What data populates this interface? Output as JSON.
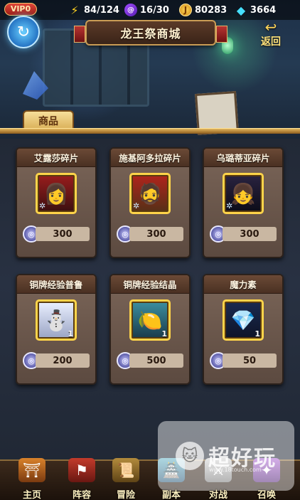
{
  "topbar": {
    "vip_label": "VIP0",
    "energy": "84/124",
    "spiral": "16/30",
    "coins": "80283",
    "gems": "3664"
  },
  "icons": {
    "energy": "lightning-icon",
    "spiral": "spiral-token-icon",
    "coin": "gold-coin-icon",
    "gem": "diamond-icon",
    "currency": "shop-token-icon"
  },
  "header": {
    "title": "龙王祭商城",
    "back_label": "返回"
  },
  "tabs": [
    {
      "label": "商品",
      "active": true
    }
  ],
  "items": [
    {
      "name": "艾露莎碎片",
      "price": "300",
      "fragment": true,
      "count": ""
    },
    {
      "name": "施基阿多拉碎片",
      "price": "300",
      "fragment": true,
      "count": ""
    },
    {
      "name": "乌璐蒂亚碎片",
      "price": "300",
      "fragment": true,
      "count": ""
    },
    {
      "name": "铜牌经验普鲁",
      "price": "200",
      "fragment": false,
      "count": "1"
    },
    {
      "name": "铜牌经验结晶",
      "price": "500",
      "fragment": false,
      "count": "1"
    },
    {
      "name": "魔力素",
      "price": "50",
      "fragment": false,
      "count": "1"
    }
  ],
  "nav": [
    {
      "label": "主页"
    },
    {
      "label": "阵容"
    },
    {
      "label": "冒险"
    },
    {
      "label": "副本"
    },
    {
      "label": "对战"
    },
    {
      "label": "召唤"
    }
  ],
  "watermark": {
    "text": "超好玩",
    "url": "www.18touch.com"
  },
  "colors": {
    "portrait_border": "#ffd44a",
    "card_body": "#6b5548",
    "price_bar": "#c9b7a2",
    "label_gold": "#ffe27a"
  }
}
